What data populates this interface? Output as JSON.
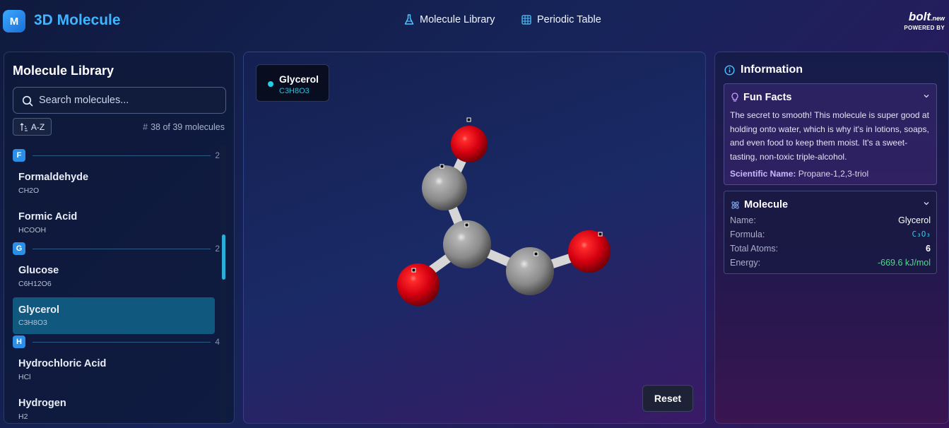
{
  "app": {
    "logo_letter": "M",
    "title": "3D Molecule"
  },
  "nav": {
    "library": "Molecule Library",
    "periodic": "Periodic Table"
  },
  "brand": {
    "name": "bolt",
    "suffix": ".new",
    "tagline": "POWERED BY"
  },
  "library": {
    "title": "Molecule Library",
    "search_placeholder": "Search molecules...",
    "sort_label": "A-Z",
    "count_text": "38 of 39 molecules",
    "groups": [
      {
        "letter": "F",
        "count": "2"
      },
      {
        "letter": "G",
        "count": "2"
      },
      {
        "letter": "H",
        "count": "4"
      }
    ],
    "items": [
      {
        "name": "Formaldehyde",
        "formula": "CH2O"
      },
      {
        "name": "Formic Acid",
        "formula": "HCOOH"
      },
      {
        "name": "Glucose",
        "formula": "C6H12O6"
      },
      {
        "name": "Glycerol",
        "formula": "C3H8O3"
      },
      {
        "name": "Hydrochloric Acid",
        "formula": "HCl"
      },
      {
        "name": "Hydrogen",
        "formula": "H2"
      }
    ]
  },
  "viewer": {
    "molecule_name": "Glycerol",
    "molecule_formula": "C3H8O3",
    "reset_label": "Reset",
    "colors": {
      "oxygen": "#e00010",
      "carbon": "#9a9a9a",
      "bond": "#d8d8d8"
    }
  },
  "info": {
    "title": "Information",
    "fun_facts": {
      "title": "Fun Facts",
      "text": "The secret to smooth! This molecule is super good at holding onto water, which is why it's in lotions, soaps, and even food to keep them moist. It's a sweet-tasting, non-toxic triple-alcohol.",
      "scientific_label": "Scientific Name:",
      "scientific_name": "Propane-1,2,3-triol"
    },
    "molecule": {
      "title": "Molecule",
      "name_label": "Name:",
      "name_value": "Glycerol",
      "formula_label": "Formula:",
      "formula_value": "C₃O₃",
      "atoms_label": "Total Atoms:",
      "atoms_value": "6",
      "energy_label": "Energy:",
      "energy_value": "-669.6 kJ/mol"
    }
  }
}
